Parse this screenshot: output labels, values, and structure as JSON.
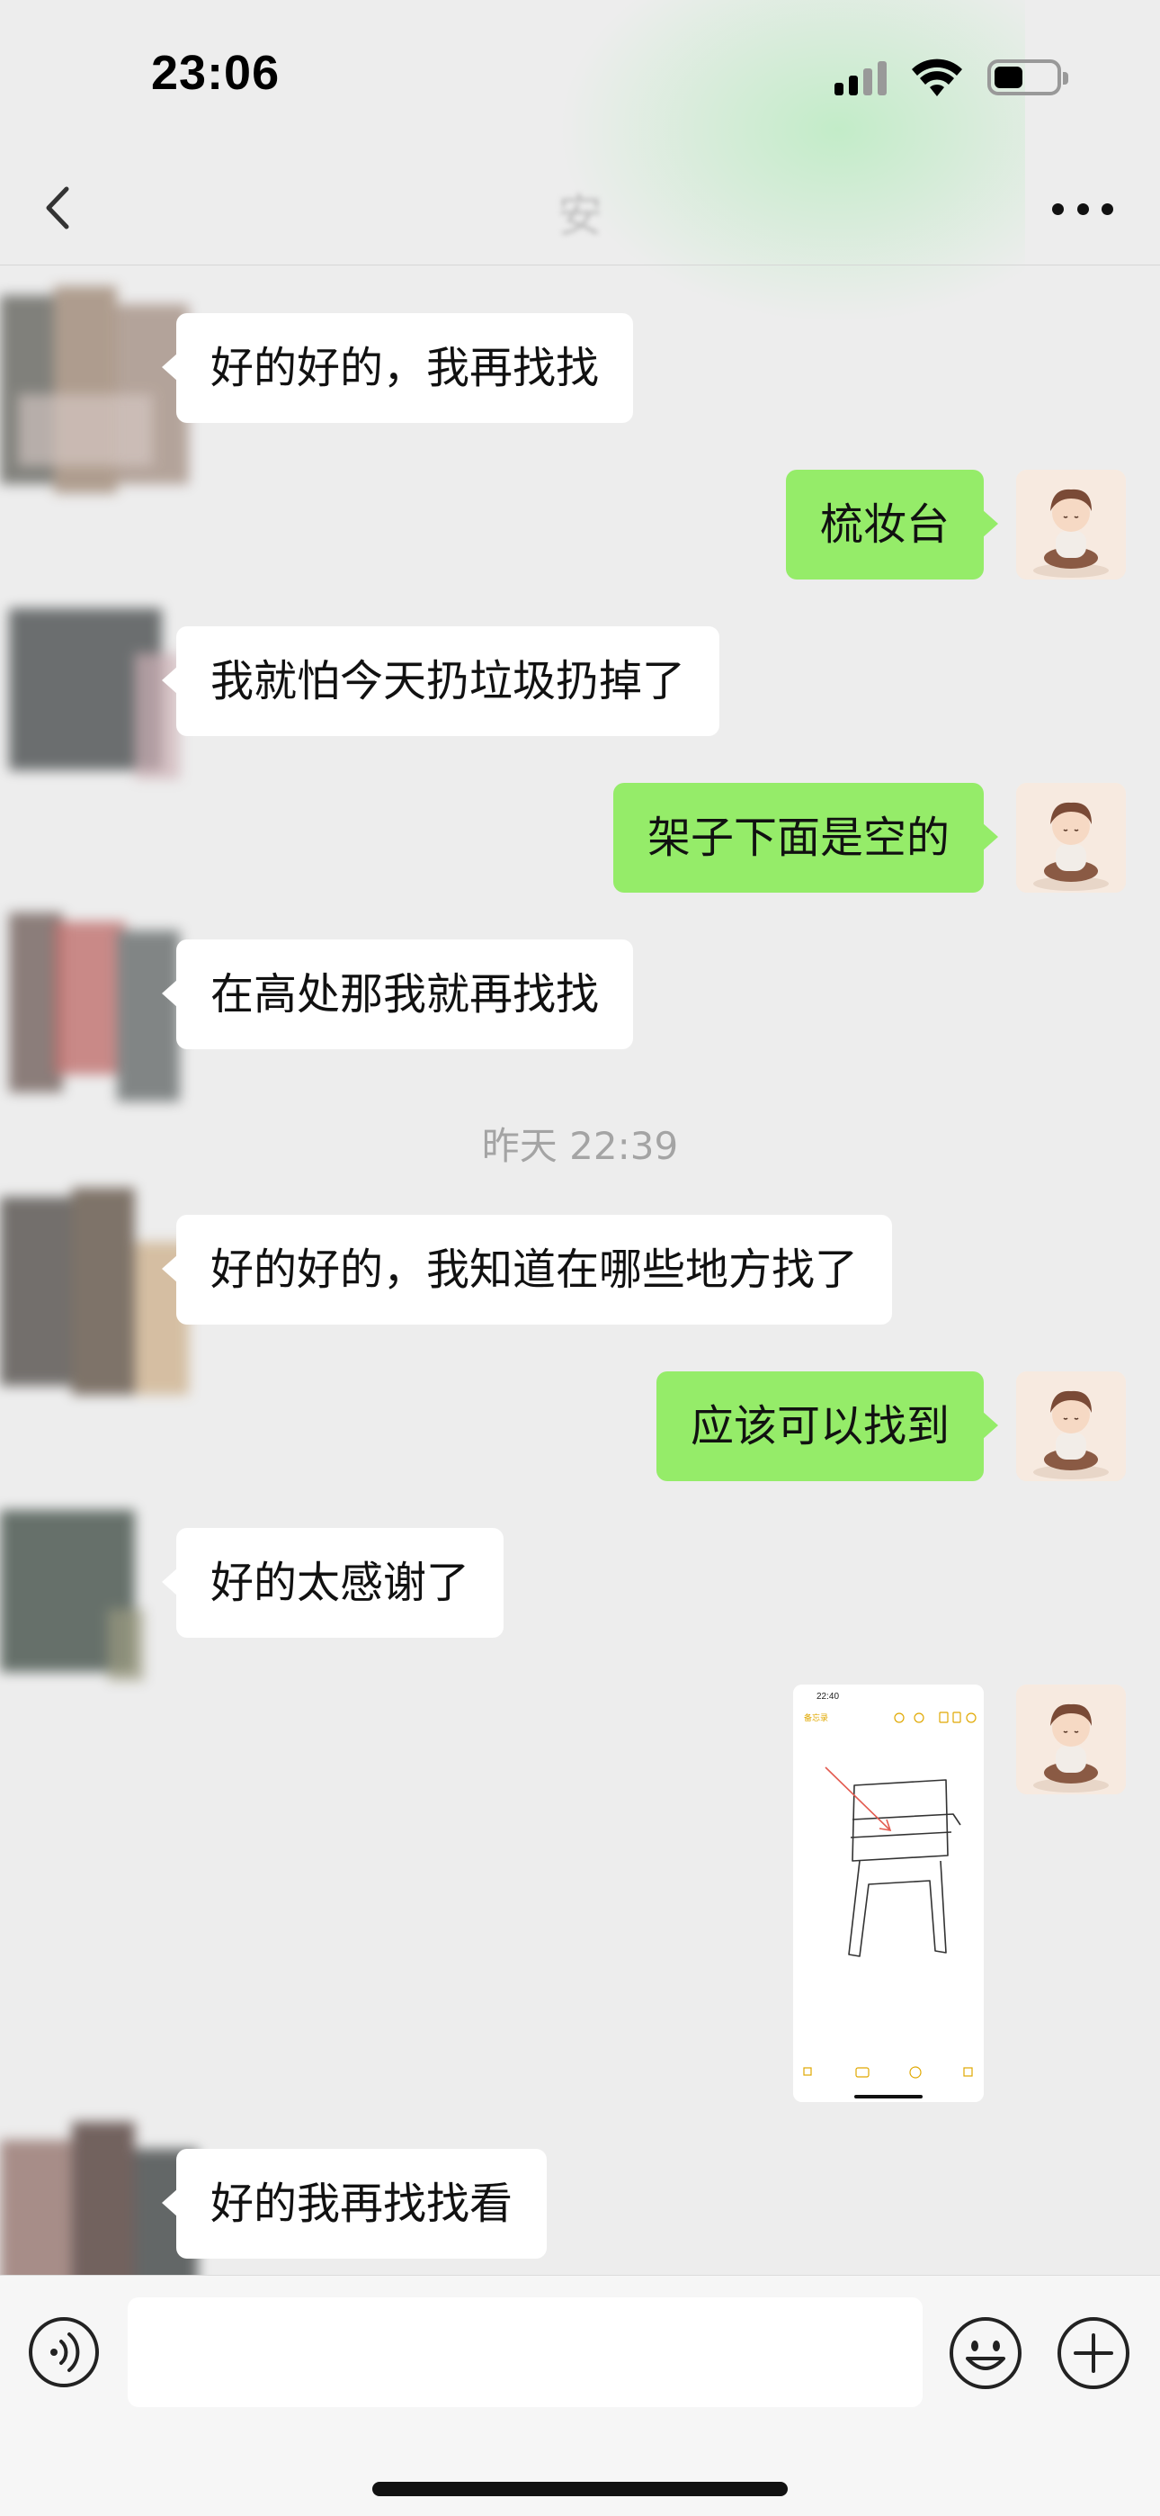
{
  "status_bar": {
    "time": "23:06",
    "battery_level": 0.52
  },
  "header": {
    "title": "安"
  },
  "messages": [
    {
      "side": "left",
      "text": "好的好的，我再找找"
    },
    {
      "side": "right",
      "text": "梳妆台"
    },
    {
      "side": "left",
      "text": "我就怕今天扔垃圾扔掉了"
    },
    {
      "side": "right",
      "text": "架子下面是空的"
    },
    {
      "side": "left",
      "text": "在高处那我就再找找"
    },
    {
      "side": "left",
      "text": "好的好的，我知道在哪些地方找了"
    },
    {
      "side": "right",
      "text": "应该可以找到"
    },
    {
      "side": "left",
      "text": "好的太感谢了"
    },
    {
      "side": "left",
      "text": "好的我再找找看"
    }
  ],
  "timestamp": "昨天 22:39",
  "image_message": {
    "inner_time": "22:40",
    "inner_back": "备忘录"
  },
  "colors": {
    "sent_bubble": "#95ec69",
    "received_bubble": "#ffffff",
    "background": "#ededed"
  },
  "icons": {
    "back": "chevron-left-icon",
    "more": "more-dots-icon",
    "voice": "voice-icon",
    "emoji": "emoji-icon",
    "plus": "plus-icon"
  }
}
